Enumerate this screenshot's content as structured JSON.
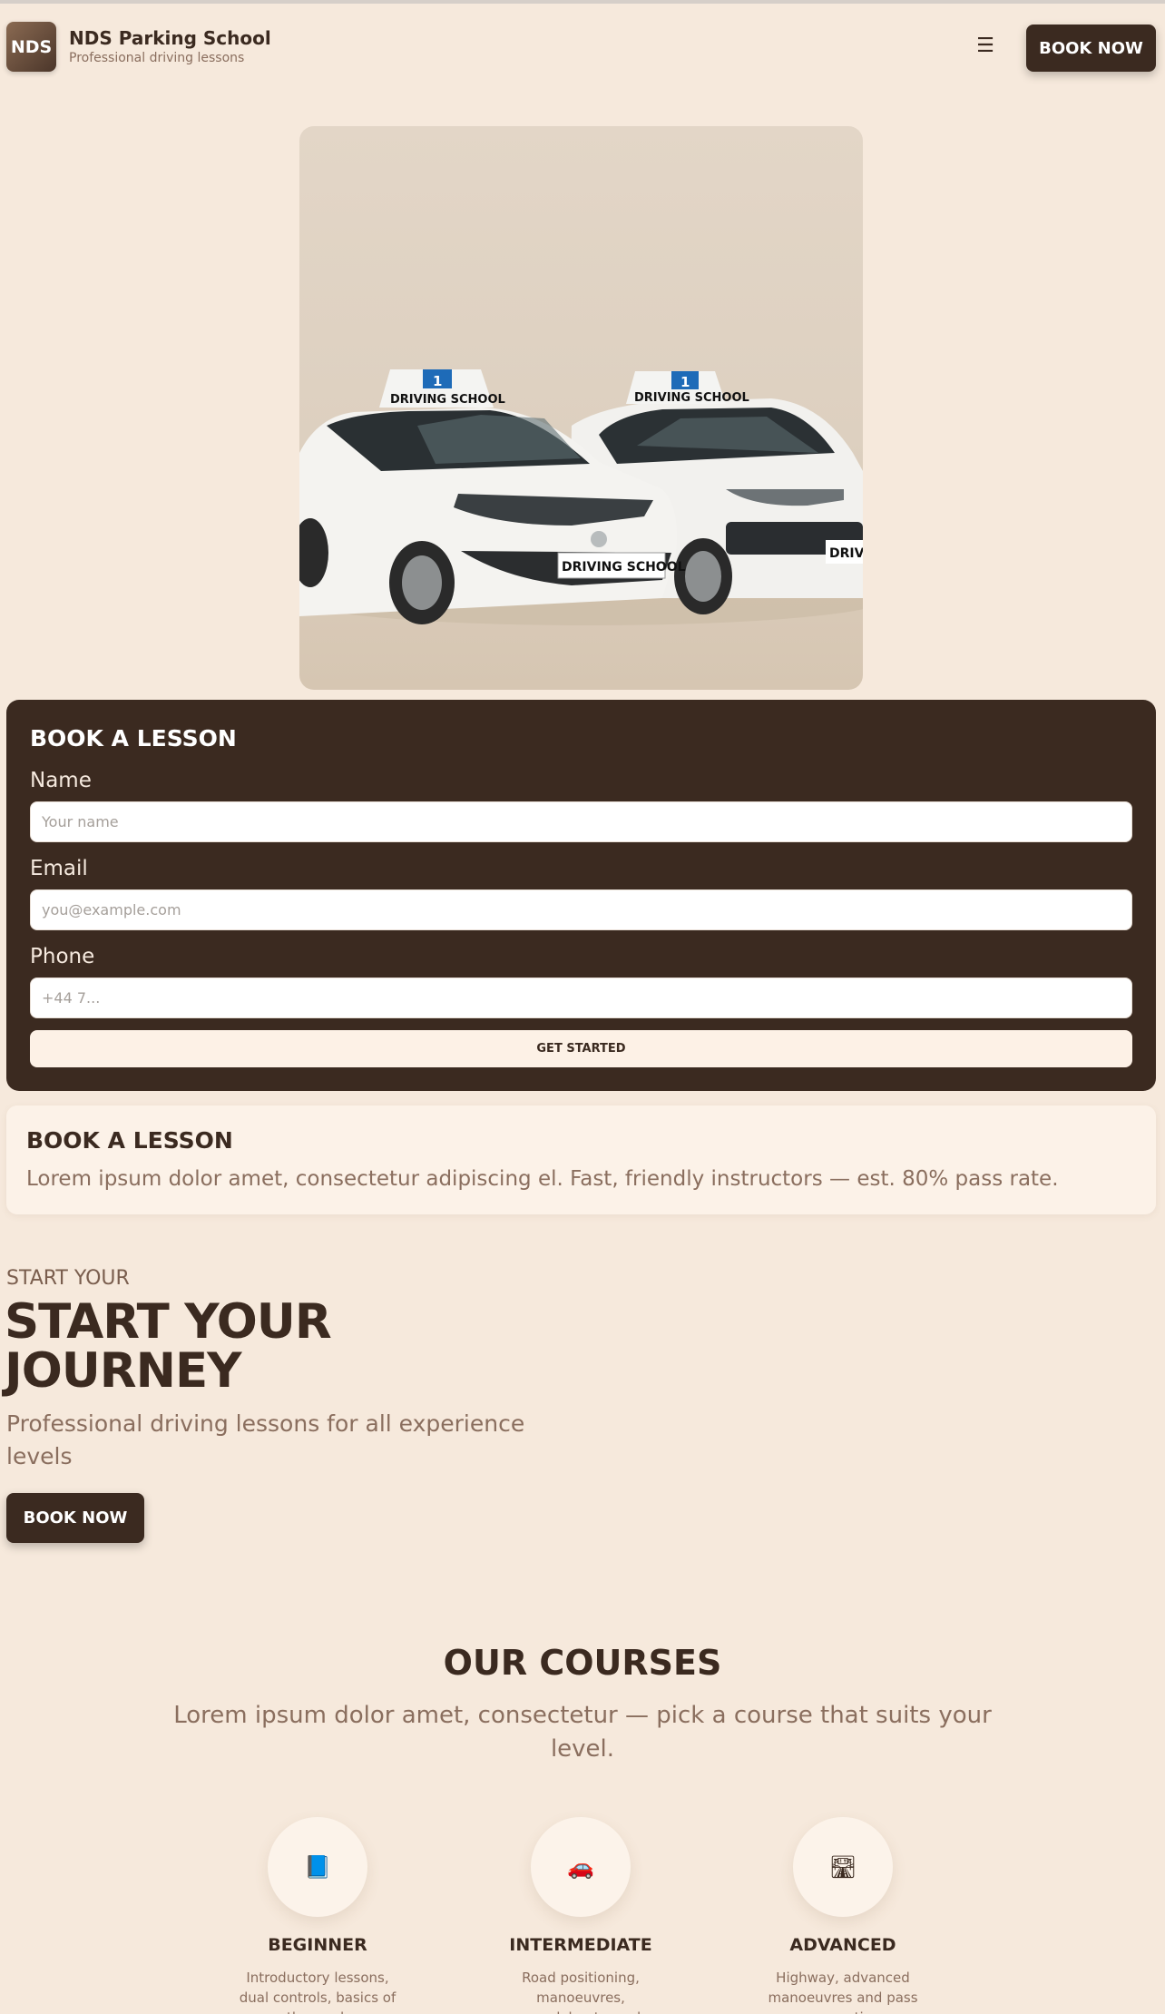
{
  "header": {
    "logo_text": "NDS",
    "brand_title": "NDS Parking School",
    "brand_subtitle": "Professional driving lessons",
    "menu_icon": "☰",
    "book_label": "BOOK NOW"
  },
  "hero_image": {
    "roof_sign_number": "1",
    "roof_sign_text": "DRIVING SCHOOL",
    "plate_text": "DRIVING SCHOOL"
  },
  "booking_form": {
    "title": "BOOK A LESSON",
    "fields": [
      {
        "label": "Name",
        "placeholder": "Your name"
      },
      {
        "label": "Email",
        "placeholder": "you@example.com"
      },
      {
        "label": "Phone",
        "placeholder": "+44 7..."
      }
    ],
    "submit_label": "GET STARTED"
  },
  "info_card": {
    "title": "BOOK A LESSON",
    "text": "Lorem ipsum dolor amet, consectetur adipiscing el. Fast, friendly instructors — est. 80% pass rate."
  },
  "hero": {
    "eyebrow": "START YOUR",
    "title_line1": "START YOUR",
    "title_line2": "JOURNEY",
    "subtitle": "Professional driving lessons for all experience levels",
    "book_label": "BOOK NOW"
  },
  "courses": {
    "title": "OUR COURSES",
    "subtitle": "Lorem ipsum dolor amet, consectetur — pick a course that suits your level.",
    "items": [
      {
        "icon": "📘",
        "icon_name": "book-icon",
        "name": "BEGINNER",
        "desc": "Introductory lessons, dual controls, basics of the road."
      },
      {
        "icon": "🚗",
        "icon_name": "car-icon",
        "name": "INTERMEDIATE",
        "desc": "Road positioning, manoeuvres, roundabouts, and confidence building."
      },
      {
        "icon": "🛣",
        "icon_name": "motorway-icon",
        "name": "ADVANCED",
        "desc": "Highway, advanced manoeuvres and pass preparation."
      }
    ]
  },
  "colors": {
    "background": "#f6e9dc",
    "brand_dark": "#3b2a20",
    "muted_text": "#8a6e5e",
    "sign_blue": "#1e6bb8"
  }
}
